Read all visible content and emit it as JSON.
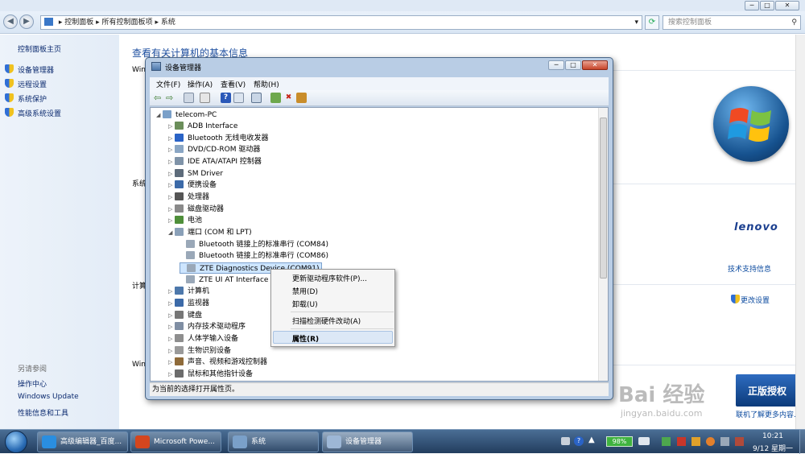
{
  "explorer": {
    "address": [
      "控制面板",
      "所有控制面板项",
      "系统"
    ],
    "search_placeholder": "搜索控制面板",
    "left_nav": {
      "home": "控制面板主页",
      "items": [
        "设备管理器",
        "远程设置",
        "系统保护",
        "高级系统设置"
      ]
    },
    "see_also": {
      "title": "另请参阅",
      "items": [
        "操作中心",
        "Windows Update",
        "性能信息和工具"
      ]
    },
    "main": {
      "heading": "查看有关计算机的基本信息",
      "frag_win": "Win",
      "frag_sys": "系统",
      "frag_calc": "计算",
      "frag_win2": "Win",
      "brand": "lenovo",
      "support_link": "技术支持信息",
      "change_settings": "更改设置",
      "genuine_badge": "正版授权",
      "learn_more": "联机了解更多内容..."
    }
  },
  "device_manager": {
    "title": "设备管理器",
    "menu": [
      "文件(F)",
      "操作(A)",
      "查看(V)",
      "帮助(H)"
    ],
    "root": "telecom-PC",
    "nodes": [
      "ADB Interface",
      "Bluetooth 无线电收发器",
      "DVD/CD-ROM 驱动器",
      "IDE ATA/ATAPI 控制器",
      "SM Driver",
      "便携设备",
      "处理器",
      "磁盘驱动器",
      "电池",
      "端口 (COM 和 LPT)",
      "Bluetooth 链接上的标准串行 (COM84)",
      "Bluetooth 链接上的标准串行 (COM86)",
      "ZTE Diagnostics Device (COM91)",
      "ZTE UI AT Interface (C",
      "计算机",
      "监视器",
      "键盘",
      "内存技术驱动程序",
      "人体学输入设备",
      "生物识别设备",
      "声音、视频和游戏控制器",
      "鼠标和其他指针设备"
    ],
    "status": "为当前的选择打开属性页。"
  },
  "context_menu": {
    "items": [
      "更新驱动程序软件(P)...",
      "禁用(D)",
      "卸载(U)",
      "扫描检测硬件改动(A)",
      "属性(R)"
    ]
  },
  "taskbar": {
    "tasks": [
      "高级编辑器_百度...",
      "Microsoft Powe...",
      "系统",
      "设备管理器"
    ],
    "battery": "98%",
    "time": "10:21",
    "date": "9/12 星期一"
  },
  "watermark": {
    "text": "Bai 经验",
    "url": "jingyan.baidu.com"
  },
  "colors": {
    "link": "#0b2a6f",
    "heading": "#1e4fa0",
    "highlight": "#cde5ff",
    "taskbar": "#2b4a6f"
  }
}
